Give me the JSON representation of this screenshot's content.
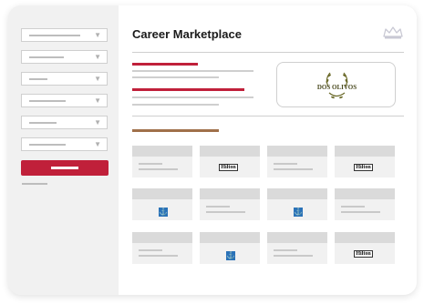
{
  "page": {
    "title": "Career Marketplace"
  },
  "brand": {
    "accent": "#c0203a",
    "divider": "#a0704a"
  },
  "featured_logo": {
    "name": "DOS OLIVOS",
    "icon": "olive-wreath-icon"
  },
  "card_logos": {
    "hilton": "Hilton",
    "anchor": "anchor-icon"
  }
}
